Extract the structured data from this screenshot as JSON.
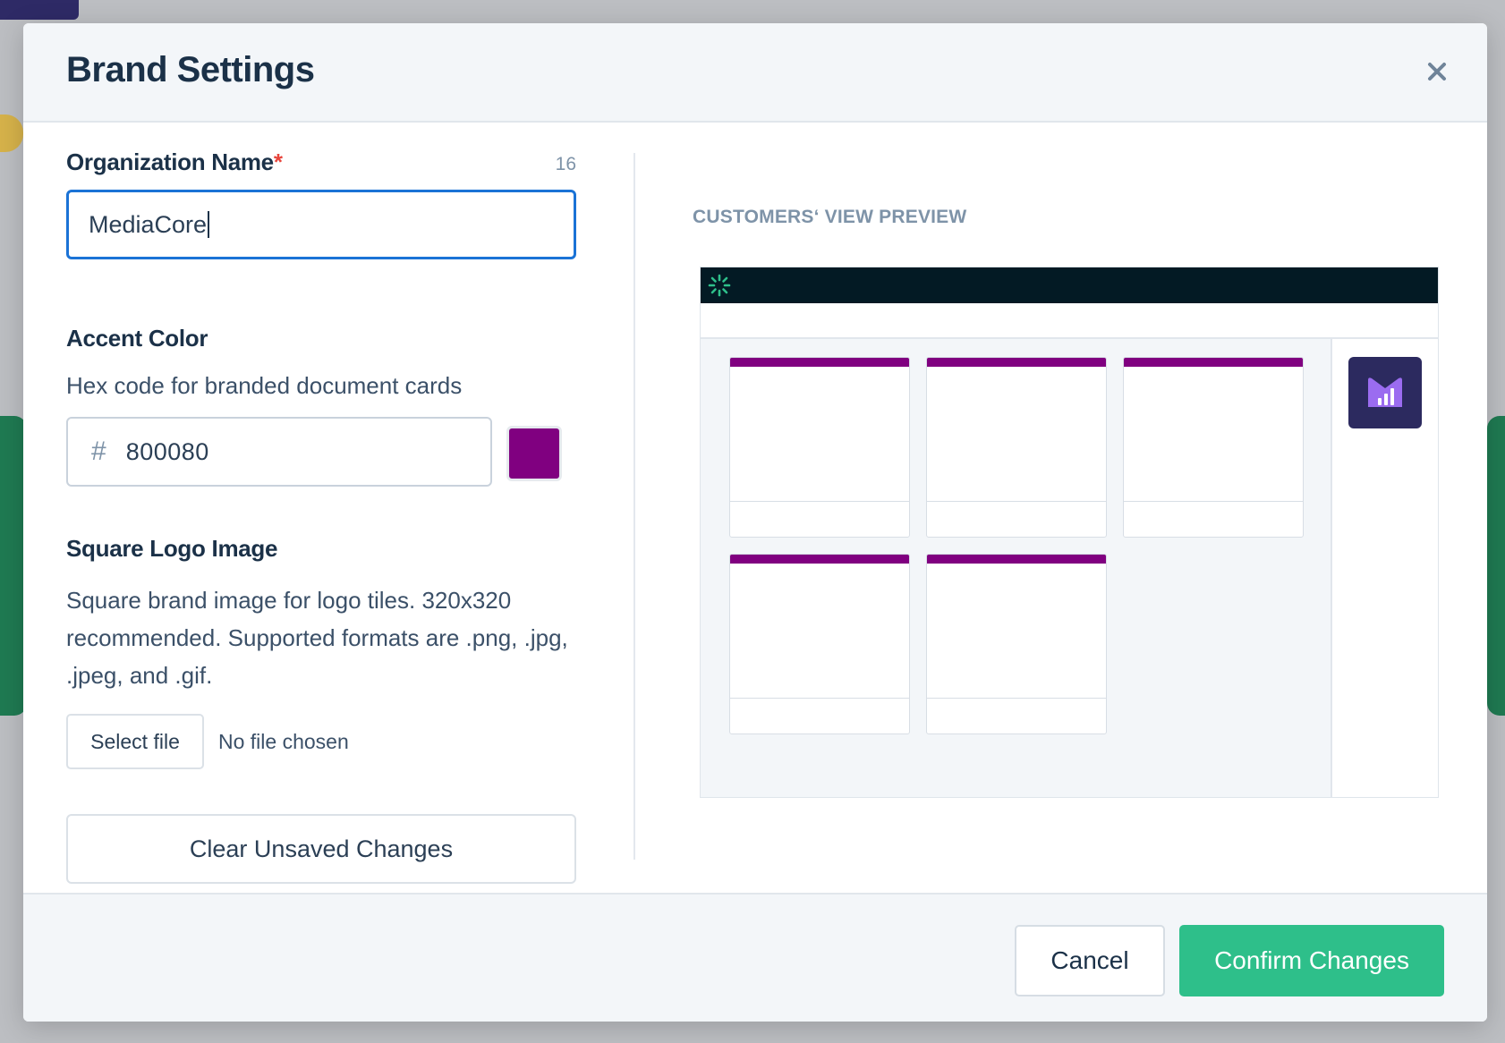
{
  "modal": {
    "title": "Brand Settings",
    "close_icon": "close-icon"
  },
  "org_name": {
    "label": "Organization Name",
    "required_mark": "*",
    "char_count": "16",
    "value": "MediaCore"
  },
  "accent_color": {
    "label": "Accent Color",
    "help": "Hex code for branded document cards",
    "hash_symbol": "#",
    "value": "800080",
    "swatch_color": "#800080"
  },
  "logo": {
    "label": "Square Logo Image",
    "help": "Square brand image for logo tiles. 320x320 recommended. Supported formats are .png, .jpg, .jpeg, and .gif.",
    "select_button": "Select file",
    "file_status": "No file chosen"
  },
  "clear_button": "Clear Unsaved Changes",
  "preview": {
    "label": "CUSTOMERS‘ VIEW PREVIEW",
    "topbar_color": "#031a24",
    "card_accent_color": "#800080",
    "card_count": 5,
    "logo_tile_color": "#2c2a5f"
  },
  "footer": {
    "cancel_label": "Cancel",
    "confirm_label": "Confirm Changes",
    "confirm_color": "#2ebf8a"
  }
}
